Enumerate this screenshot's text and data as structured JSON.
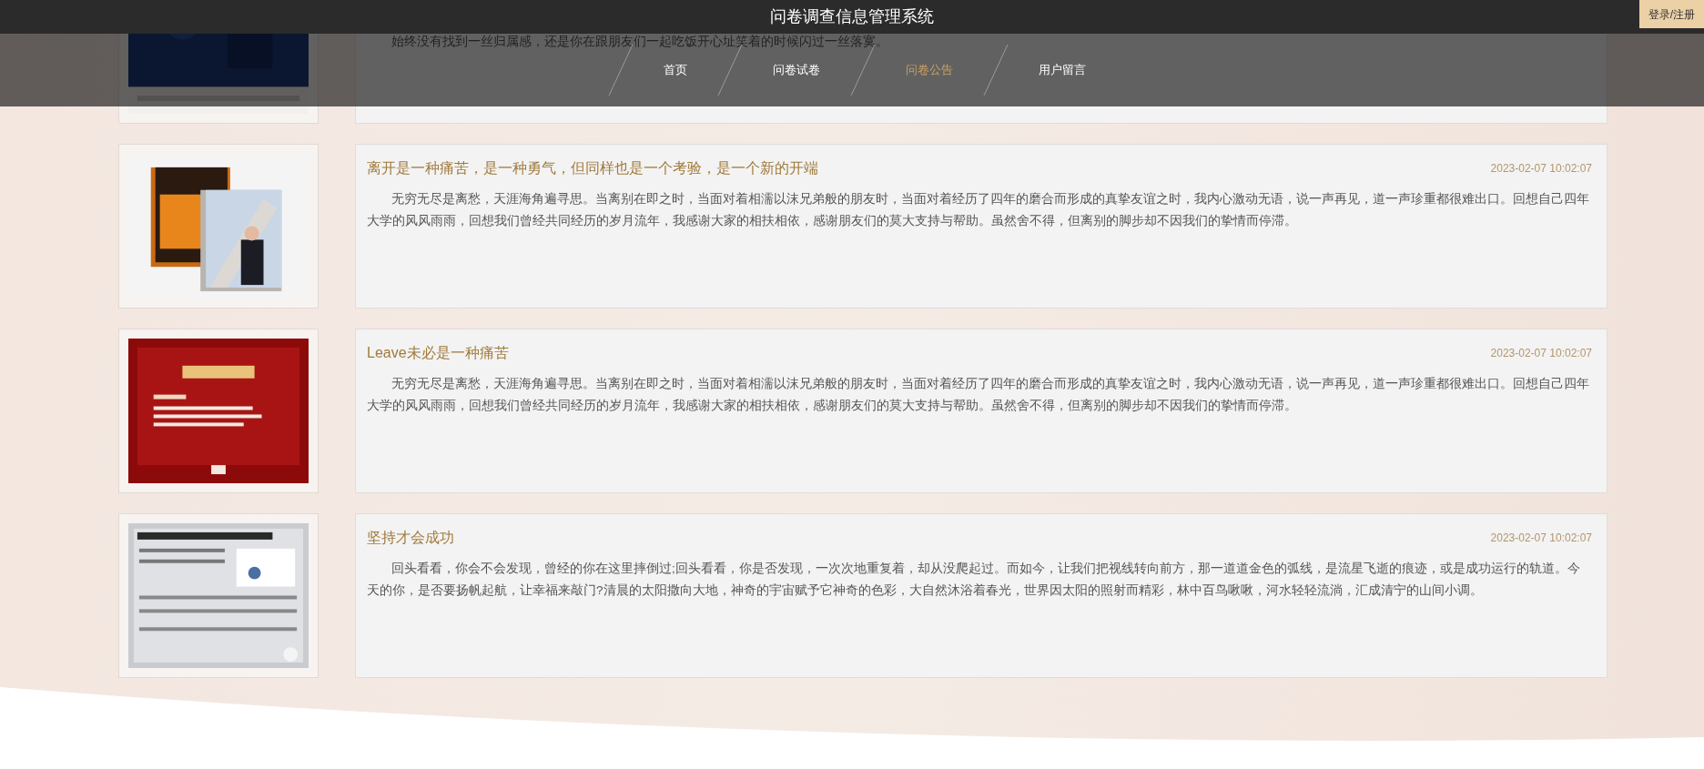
{
  "header": {
    "title": "问卷调查信息管理系统",
    "login_button": "登录/注册"
  },
  "nav": [
    {
      "label": "首页",
      "selected": false
    },
    {
      "label": "问卷试卷",
      "selected": false
    },
    {
      "label": "问卷公告",
      "selected": true
    },
    {
      "label": "用户留言",
      "selected": false
    }
  ],
  "notices": [
    {
      "body": "始终没有找到一丝归属感，还是你在跟朋友们一起吃饭开心址笑着的时候闪过一丝落寞。"
    },
    {
      "title": "离开是一种痛苦，是一种勇气，但同样也是一个考验，是一个新的开端",
      "date": "2023-02-07 10:02:07",
      "body": "无穷无尽是离愁，天涯海角遍寻思。当离别在即之时，当面对着相濡以沫兄弟般的朋友时，当面对着经历了四年的磨合而形成的真挚友谊之时，我内心激动无语，说一声再见，道一声珍重都很难出口。回想自己四年大学的风风雨雨，回想我们曾经共同经历的岁月流年，我感谢大家的相扶相依，感谢朋友们的莫大支持与帮助。虽然舍不得，但离别的脚步却不因我们的挚情而停滞。"
    },
    {
      "title": "Leave未必是一种痛苦",
      "date": "2023-02-07 10:02:07",
      "body": "无穷无尽是离愁，天涯海角遍寻思。当离别在即之时，当面对着相濡以沫兄弟般的朋友时，当面对着经历了四年的磨合而形成的真挚友谊之时，我内心激动无语，说一声再见，道一声珍重都很难出口。回想自己四年大学的风风雨雨，回想我们曾经共同经历的岁月流年，我感谢大家的相扶相依，感谢朋友们的莫大支持与帮助。虽然舍不得，但离别的脚步却不因我们的挚情而停滞。"
    },
    {
      "title": "坚持才会成功",
      "date": "2023-02-07 10:02:07",
      "body": "回头看看，你会不会发现，曾经的你在这里摔倒过;回头看看，你是否发现，一次次地重复着，却从没爬起过。而如今，让我们把视线转向前方，那一道道金色的弧线，是流星飞逝的痕迹，或是成功运行的轨道。今天的你，是否要扬帆起航，让幸福来敲门?清晨的太阳撒向大地，神奇的宇宙赋予它神奇的色彩，大自然沐浴着春光，世界因太阳的照射而精彩，林中百鸟啾啾，河水轻轻流淌，汇成清宁的山间小调。"
    }
  ]
}
